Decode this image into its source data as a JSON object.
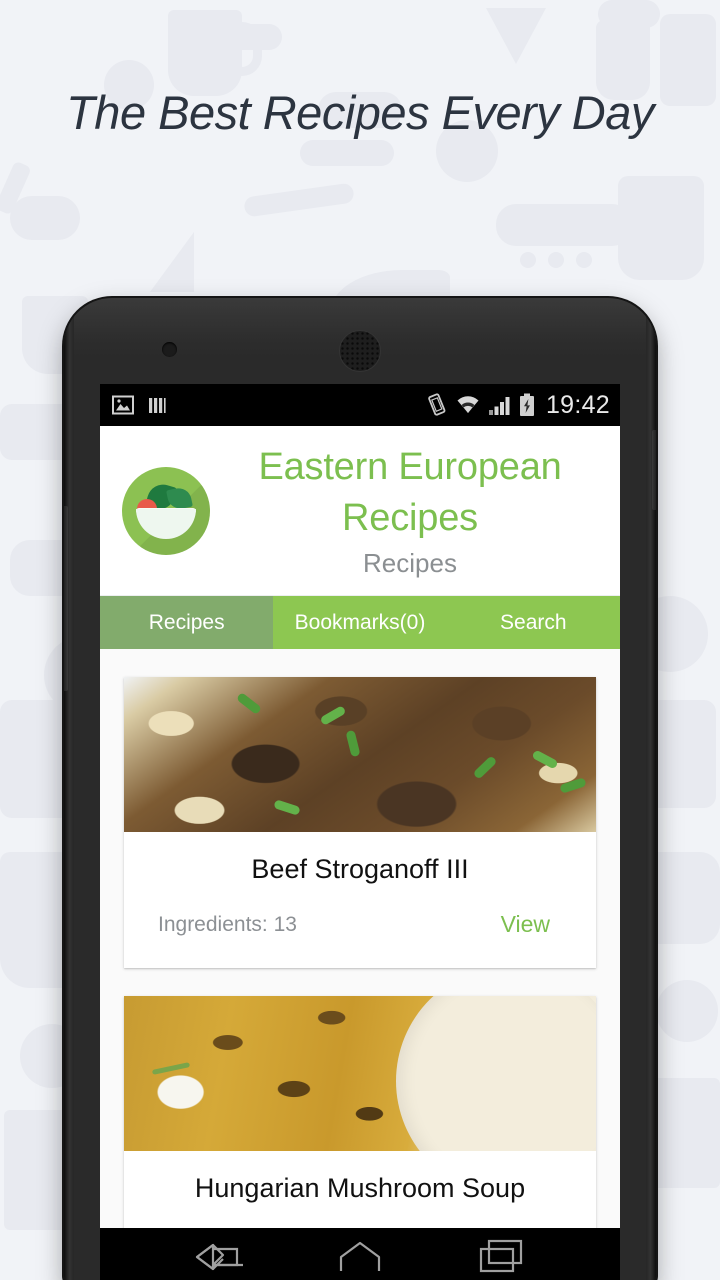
{
  "promo": {
    "headline": "The Best Recipes Every Day",
    "background_color": "#f1f3f7",
    "headline_color": "#2c3440"
  },
  "device": {
    "frame_color": "#2a2a2a",
    "camera": "camera-dot",
    "speaker": "earpiece-speaker"
  },
  "statusbar": {
    "background": "#000000",
    "left_icons": [
      "image-icon",
      "bars-icon"
    ],
    "right_icons": [
      "screen-rotation-icon",
      "wifi-icon",
      "signal-icon",
      "battery-charging-icon"
    ],
    "time": "19:42"
  },
  "appbar": {
    "logo": "salad-bowl-logo",
    "title": "Eastern European Recipes",
    "subtitle": "Recipes",
    "title_color": "#7CBF4F",
    "subtitle_color": "#8b8f92"
  },
  "tabs": {
    "active_color": "#82AB6C",
    "inactive_color": "#8DC751",
    "items": [
      {
        "label": "Recipes",
        "active": true
      },
      {
        "label": "Bookmarks(0)",
        "active": false
      },
      {
        "label": "Search",
        "active": false
      }
    ]
  },
  "recipes": [
    {
      "photo": "beef-stroganoff-photo",
      "title": "Beef Stroganoff III",
      "ingredients_label": "Ingredients: 13",
      "view_label": "View",
      "view_color": "#7CBF4F"
    },
    {
      "photo": "hungarian-mushroom-soup-photo",
      "title": "Hungarian Mushroom Soup",
      "ingredients_label": "",
      "view_label": "",
      "view_color": "#7CBF4F"
    }
  ],
  "navbar": {
    "buttons": [
      "back-icon",
      "home-icon",
      "recents-icon"
    ]
  }
}
